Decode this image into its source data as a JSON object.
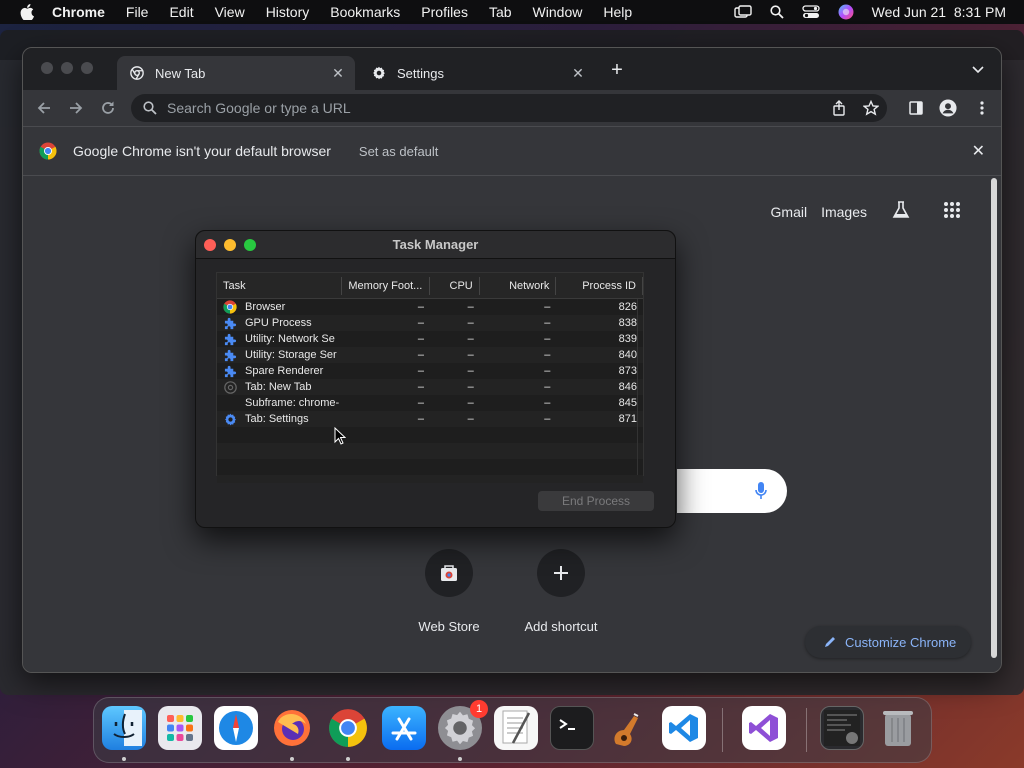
{
  "menubar": {
    "app_name": "Chrome",
    "items": [
      "File",
      "Edit",
      "View",
      "History",
      "Bookmarks",
      "Profiles",
      "Tab",
      "Window",
      "Help"
    ],
    "clock": "Wed Jun 21  8:31 PM"
  },
  "browser": {
    "tabs": [
      {
        "label": "New Tab",
        "icon": "chrome-icon",
        "active": true
      },
      {
        "label": "Settings",
        "icon": "gear-icon",
        "active": false
      }
    ],
    "omnibox_placeholder": "Search Google or type a URL",
    "infobar": {
      "message": "Google Chrome isn't your default browser",
      "action": "Set as default"
    },
    "ntp_links": {
      "gmail": "Gmail",
      "images": "Images"
    },
    "shortcuts": [
      {
        "label": "Web Store",
        "icon": "web-store-icon"
      },
      {
        "label": "Add shortcut",
        "icon": "plus-icon"
      }
    ],
    "customize_label": "Customize Chrome"
  },
  "task_manager": {
    "title": "Task Manager",
    "columns": [
      "Task",
      "Memory Foot...",
      "CPU",
      "Network",
      "Process ID"
    ],
    "rows": [
      {
        "task": "Browser",
        "icon": "chrome-icon",
        "memory": "–",
        "cpu": "–",
        "network": "–",
        "pid": "826"
      },
      {
        "task": "GPU Process",
        "icon": "puzzle-icon",
        "memory": "–",
        "cpu": "–",
        "network": "–",
        "pid": "838"
      },
      {
        "task": "Utility: Network Se",
        "icon": "puzzle-icon",
        "memory": "–",
        "cpu": "–",
        "network": "–",
        "pid": "839"
      },
      {
        "task": "Utility: Storage Ser",
        "icon": "puzzle-icon",
        "memory": "–",
        "cpu": "–",
        "network": "–",
        "pid": "840"
      },
      {
        "task": "Spare Renderer",
        "icon": "puzzle-icon",
        "memory": "–",
        "cpu": "–",
        "network": "–",
        "pid": "873"
      },
      {
        "task": "Tab: New Tab",
        "icon": "chrome-outline-icon",
        "memory": "–",
        "cpu": "–",
        "network": "–",
        "pid": "846"
      },
      {
        "task": "Subframe: chrome-",
        "icon": "",
        "memory": "–",
        "cpu": "–",
        "network": "–",
        "pid": "845"
      },
      {
        "task": "Tab: Settings",
        "icon": "gear-icon",
        "memory": "–",
        "cpu": "–",
        "network": "–",
        "pid": "871"
      }
    ],
    "end_process_label": "End Process"
  },
  "dock": {
    "apps": [
      "Finder",
      "Launchpad",
      "Safari",
      "Firefox",
      "Chrome",
      "App Store",
      "System Settings",
      "TextEdit",
      "Terminal",
      "GarageBand",
      "Visual Studio Code",
      "Visual Studio",
      "Screenshot",
      "Trash"
    ],
    "system_settings_badge": "1"
  }
}
